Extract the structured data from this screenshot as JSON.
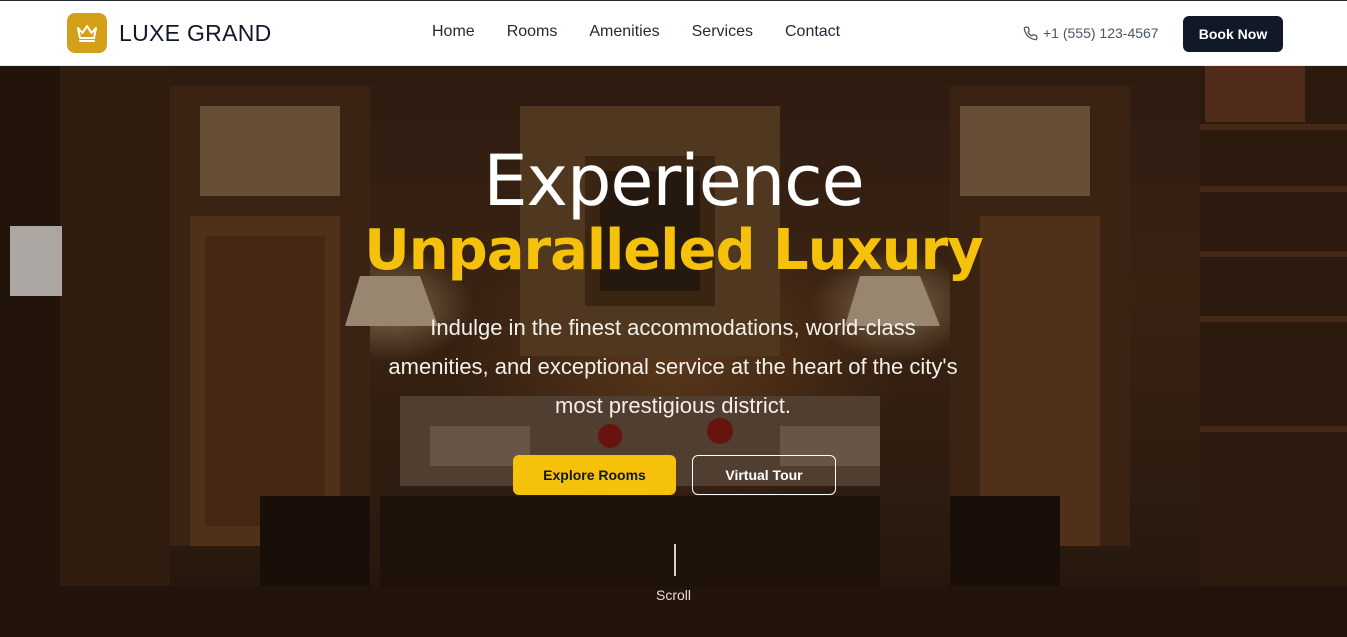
{
  "brand": {
    "name": "LUXE GRAND",
    "icon": "crown-icon",
    "accent": "#d4a017"
  },
  "nav": {
    "items": [
      "Home",
      "Rooms",
      "Amenities",
      "Services",
      "Contact"
    ]
  },
  "contact": {
    "phone": "+1 (555) 123-4567",
    "icon": "phone-icon"
  },
  "header_cta": {
    "label": "Book Now",
    "color": "#111827"
  },
  "hero": {
    "title_line1": "Experience",
    "title_line2": "Unparalleled Luxury",
    "title_accent": "#f5c10a",
    "description_lines": [
      "Indulge in the finest accommodations, world-class",
      "amenities, and exceptional service at the heart of the city's",
      "most prestigious district."
    ],
    "primary_button": "Explore Rooms",
    "secondary_button": "Virtual Tour",
    "scroll_label": "Scroll"
  }
}
